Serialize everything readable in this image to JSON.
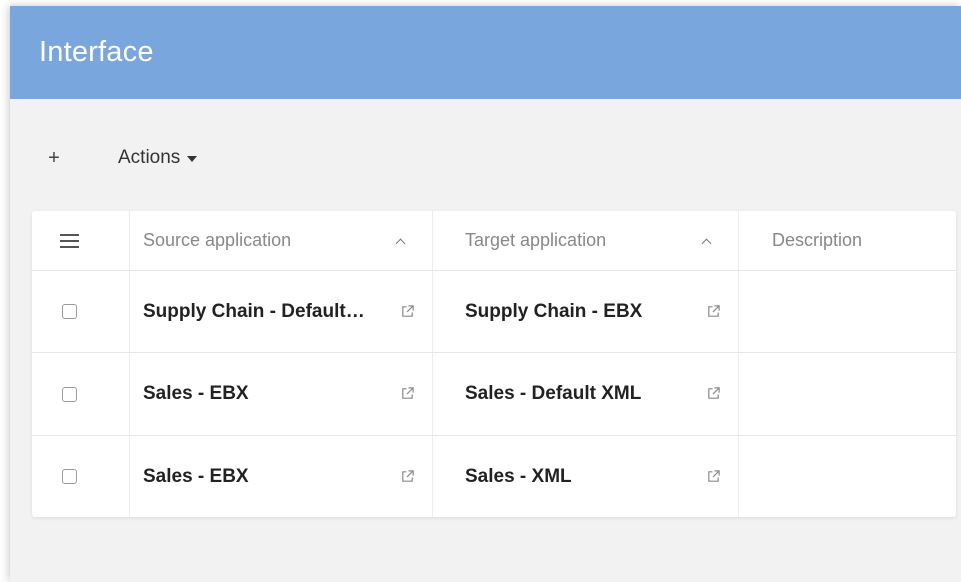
{
  "header": {
    "title": "Interface"
  },
  "toolbar": {
    "add_label": "+",
    "actions_label": "Actions"
  },
  "table": {
    "columns": [
      {
        "label": "Source application",
        "sort": "ascending"
      },
      {
        "label": "Target application",
        "sort": "ascending"
      },
      {
        "label": "Description"
      }
    ],
    "rows": [
      {
        "source": "Supply Chain - Default XML",
        "target": "Supply Chain - EBX",
        "description": ""
      },
      {
        "source": "Sales - EBX",
        "target": "Sales - Default XML",
        "description": ""
      },
      {
        "source": "Sales - EBX",
        "target": "Sales - XML",
        "description": ""
      }
    ]
  },
  "icons": {
    "menu": "menu-icon",
    "sort": "chevron-up-icon",
    "external": "external-link-icon",
    "actions_caret": "caret-down-icon"
  },
  "colors": {
    "header_bg": "#79a6dc",
    "page_bg": "#f2f2f2"
  }
}
